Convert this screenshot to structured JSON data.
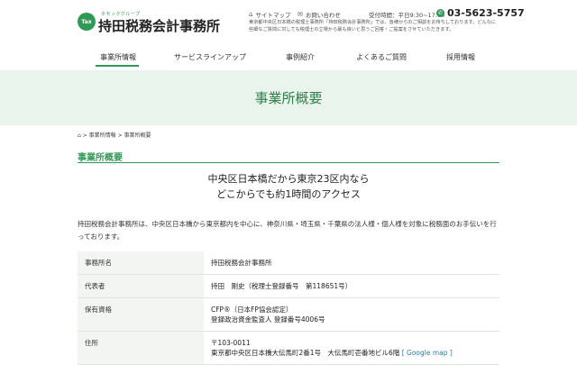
{
  "header": {
    "logo_mark": "Tax",
    "logo_sub": "タモックグループ",
    "logo_main": "持田税務会計事務所",
    "sitemap": "サイトマップ",
    "contact": "お問い合わせ",
    "hours": "受付時間：平日9:30~17:00",
    "phone": "03-5623-5757",
    "intro": "東京都中央区日本橋の税理士事務所「持田税務会計事務所」では、皆様からのご相談をお待ちしております。どんなに些細なご質問に対しても税理士の立場から最も良いと思うご回答・ご提案をさせていただきます。"
  },
  "nav": {
    "items": [
      "事業所情報",
      "サービスラインアップ",
      "事例紹介",
      "よくあるご質問",
      "採用情報"
    ]
  },
  "banner": {
    "title": "事業所概要"
  },
  "breadcrumb": "> 事業所情報 > 事業所概要",
  "section": {
    "title": "事業所概要",
    "lead1": "中央区日本橋だから東京23区内なら",
    "lead2": "どこからでも約1時間のアクセス",
    "desc": "持田税務会計事務所は、中央区日本橋から東京都内を中心に、神奈川県・埼玉県・千葉県の法人様・個人様を対象に税務面のお手伝いを行っております。"
  },
  "table": {
    "rows": [
      {
        "k": "事務所名",
        "v1": "持田税務会計事務所",
        "v2": ""
      },
      {
        "k": "代表者",
        "v1": "持田　剛史（税理士登録番号　第118651号）",
        "v2": ""
      },
      {
        "k": "保有資格",
        "v1": "CFP®（日本FP協会認定）",
        "v2": "登録政治資金監査人 登録番号4006号"
      },
      {
        "k": "住所",
        "v1": "〒103-0011",
        "v2": "東京都中央区日本橋大伝馬町2番1号　大伝馬町壱番地ビル6階"
      }
    ],
    "map_link": "[ Google map ]"
  },
  "colors": {
    "accent": "#2f9a55",
    "banner": "#e9f5ec"
  }
}
